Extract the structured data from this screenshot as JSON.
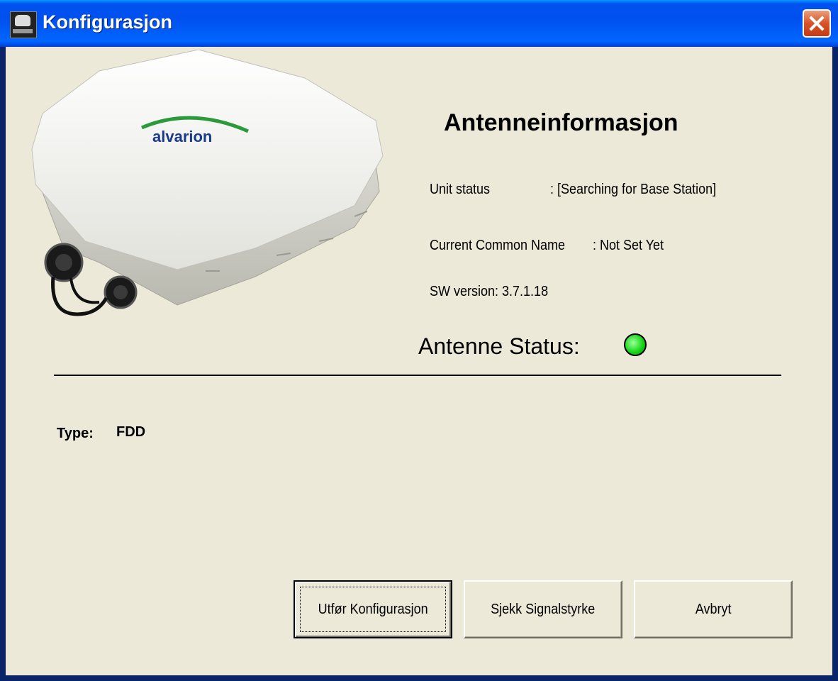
{
  "window": {
    "title": "Konfigurasjon"
  },
  "device_image": {
    "brand": "alvarion"
  },
  "info": {
    "heading": "Antenneinformasjon",
    "unit_status_label": "Unit status",
    "unit_status_value": ": [Searching for Base Station]",
    "common_name_label": "Current Common Name",
    "common_name_value": ": Not Set Yet",
    "sw_version": "SW version: 3.7.1.18",
    "antenna_status_label": "Antenne Status:",
    "antenna_status_color": "#18d818"
  },
  "type": {
    "label": "Type:",
    "value": "FDD"
  },
  "buttons": {
    "configure": "Utfør Konfigurasjon",
    "signal": "Sjekk Signalstyrke",
    "cancel": "Avbryt"
  }
}
